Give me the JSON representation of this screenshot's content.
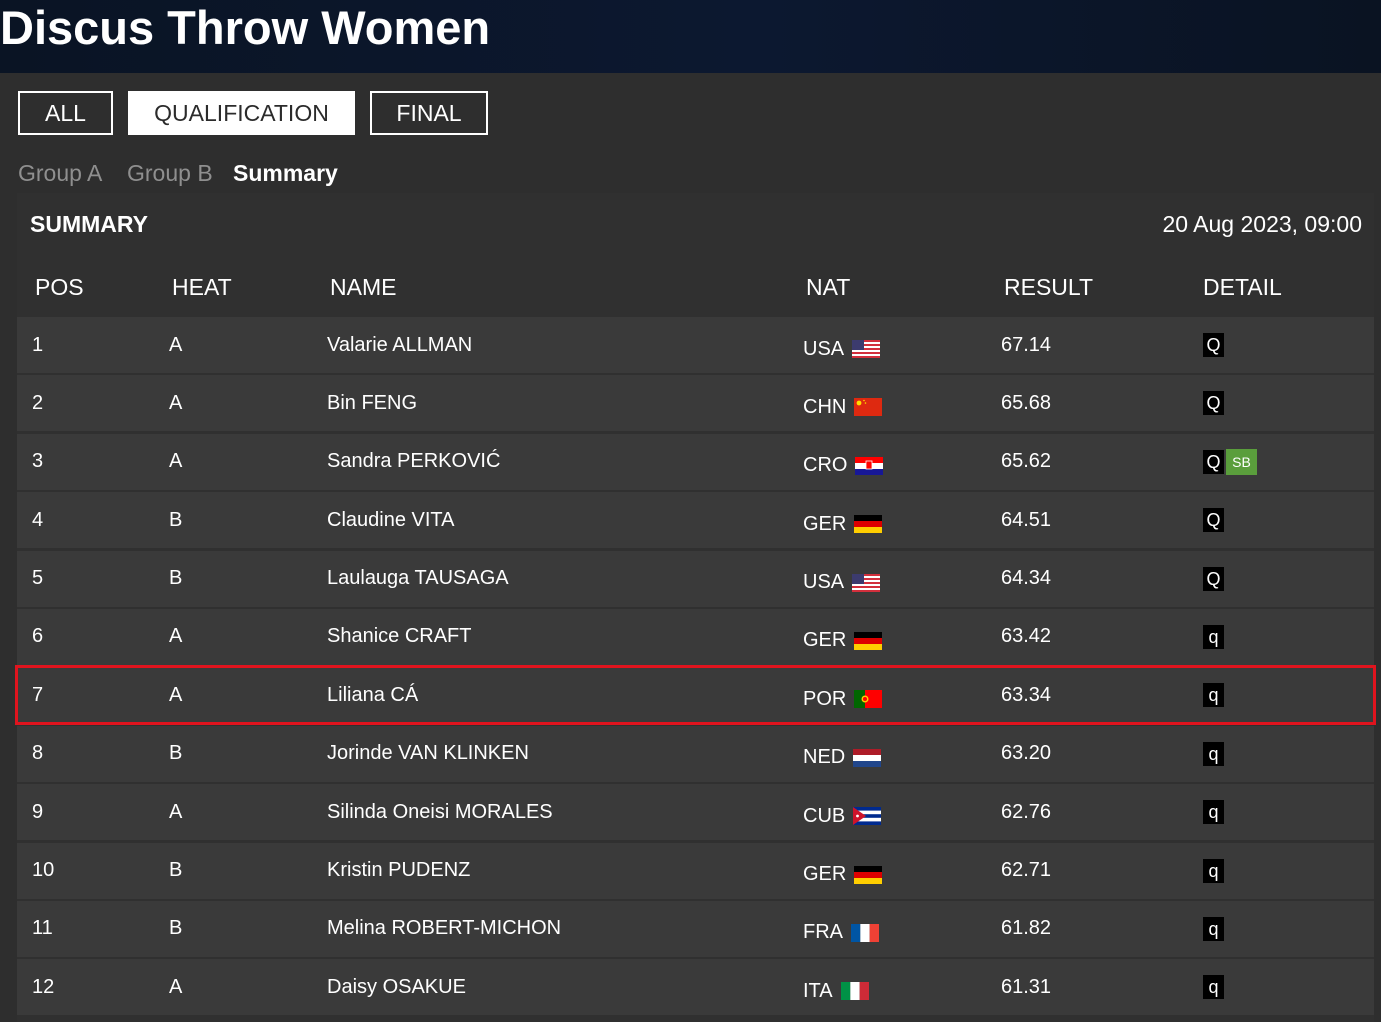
{
  "page": {
    "title": "Discus Throw Women"
  },
  "tabs": {
    "all": "ALL",
    "qualification": "QUALIFICATION",
    "final": "FINAL",
    "active": "QUALIFICATION"
  },
  "sub_tabs": {
    "group_a": "Group A",
    "group_b": "Group B",
    "summary": "Summary",
    "active": "Summary"
  },
  "summary": {
    "heading": "SUMMARY",
    "date": "20 Aug 2023, 09:00"
  },
  "columns": {
    "pos": "POS",
    "heat": "HEAT",
    "name": "NAME",
    "nat": "NAT",
    "result": "RESULT",
    "detail": "DETAIL"
  },
  "highlighted_row_pos": "7",
  "colors": {
    "highlight_border": "#e0141e",
    "sb_badge": "#5a9e3c"
  },
  "rows": [
    {
      "pos": "1",
      "heat": "A",
      "name": "Valarie ALLMAN",
      "nat": "USA",
      "flag": "usa-flag-icon",
      "result": "67.14",
      "detail": "Q",
      "extra": ""
    },
    {
      "pos": "2",
      "heat": "A",
      "name": "Bin FENG",
      "nat": "CHN",
      "flag": "chn-flag-icon",
      "result": "65.68",
      "detail": "Q",
      "extra": ""
    },
    {
      "pos": "3",
      "heat": "A",
      "name": "Sandra PERKOVIĆ",
      "nat": "CRO",
      "flag": "cro-flag-icon",
      "result": "65.62",
      "detail": "Q",
      "extra": "SB"
    },
    {
      "pos": "4",
      "heat": "B",
      "name": "Claudine VITA",
      "nat": "GER",
      "flag": "ger-flag-icon",
      "result": "64.51",
      "detail": "Q",
      "extra": ""
    },
    {
      "pos": "5",
      "heat": "B",
      "name": "Laulauga TAUSAGA",
      "nat": "USA",
      "flag": "usa-flag-icon",
      "result": "64.34",
      "detail": "Q",
      "extra": ""
    },
    {
      "pos": "6",
      "heat": "A",
      "name": "Shanice CRAFT",
      "nat": "GER",
      "flag": "ger-flag-icon",
      "result": "63.42",
      "detail": "q",
      "extra": ""
    },
    {
      "pos": "7",
      "heat": "A",
      "name": "Liliana CÁ",
      "nat": "POR",
      "flag": "por-flag-icon",
      "result": "63.34",
      "detail": "q",
      "extra": ""
    },
    {
      "pos": "8",
      "heat": "B",
      "name": "Jorinde VAN KLINKEN",
      "nat": "NED",
      "flag": "ned-flag-icon",
      "result": "63.20",
      "detail": "q",
      "extra": ""
    },
    {
      "pos": "9",
      "heat": "A",
      "name": "Silinda Oneisi MORALES",
      "nat": "CUB",
      "flag": "cub-flag-icon",
      "result": "62.76",
      "detail": "q",
      "extra": ""
    },
    {
      "pos": "10",
      "heat": "B",
      "name": "Kristin PUDENZ",
      "nat": "GER",
      "flag": "ger-flag-icon",
      "result": "62.71",
      "detail": "q",
      "extra": ""
    },
    {
      "pos": "11",
      "heat": "B",
      "name": "Melina ROBERT-MICHON",
      "nat": "FRA",
      "flag": "fra-flag-icon",
      "result": "61.82",
      "detail": "q",
      "extra": ""
    },
    {
      "pos": "12",
      "heat": "A",
      "name": "Daisy OSAKUE",
      "nat": "ITA",
      "flag": "ita-flag-icon",
      "result": "61.31",
      "detail": "q",
      "extra": ""
    }
  ]
}
